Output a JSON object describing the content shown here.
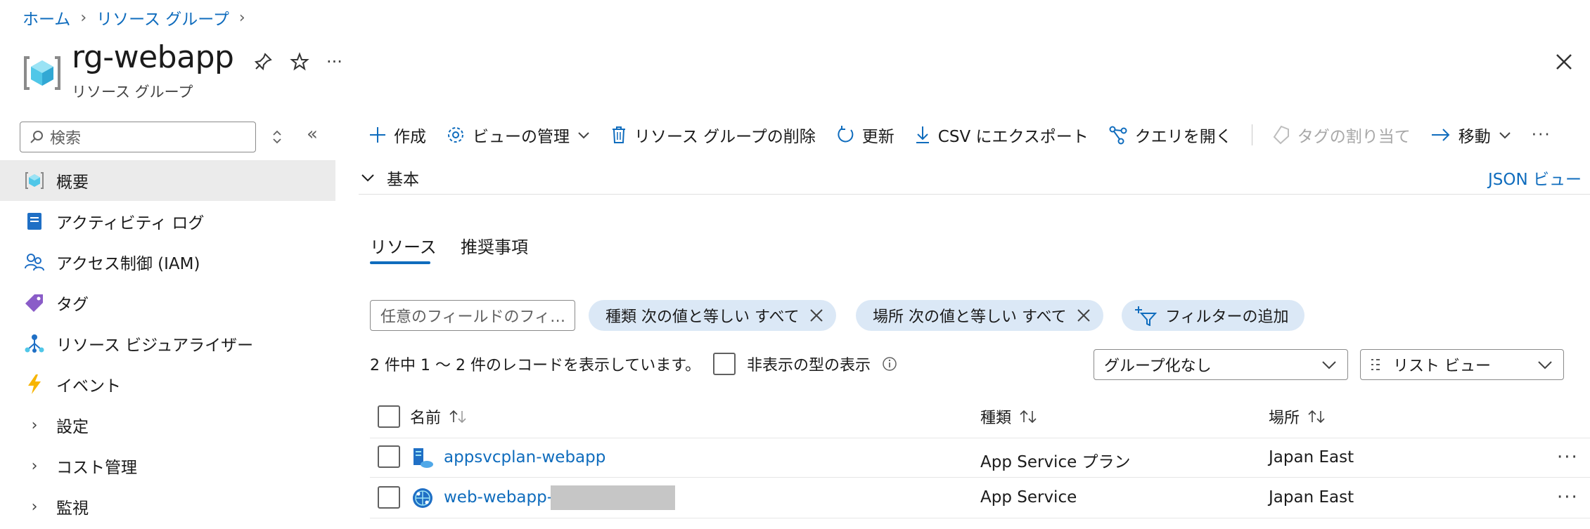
{
  "breadcrumb": {
    "home": "ホーム",
    "resource_groups": "リソース グループ"
  },
  "header": {
    "title": "rg-webapp",
    "subtitle": "リソース グループ"
  },
  "sidebar": {
    "search_placeholder": "検索",
    "items": [
      {
        "label": "概要",
        "icon": "resource-group-icon",
        "active": true
      },
      {
        "label": "アクティビティ ログ",
        "icon": "activity-log-icon"
      },
      {
        "label": "アクセス制御 (IAM)",
        "icon": "iam-icon"
      },
      {
        "label": "タグ",
        "icon": "tag-icon"
      },
      {
        "label": "リソース ビジュアライザー",
        "icon": "visualizer-icon"
      },
      {
        "label": "イベント",
        "icon": "lightning-icon"
      },
      {
        "label": "設定",
        "expandable": true
      },
      {
        "label": "コスト管理",
        "expandable": true
      },
      {
        "label": "監視",
        "expandable": true
      }
    ]
  },
  "toolbar": {
    "create": "作成",
    "manage_view": "ビューの管理",
    "delete_rg": "リソース グループの削除",
    "refresh": "更新",
    "export_csv": "CSV にエクスポート",
    "open_query": "クエリを開く",
    "assign_tags": "タグの割り当て",
    "move": "移動"
  },
  "essentials": {
    "label": "基本",
    "json_view": "JSON ビュー"
  },
  "tabs": {
    "resources": "リソース",
    "recommendations": "推奨事項"
  },
  "filters": {
    "field_placeholder": "任意のフィールドのフィ…",
    "type_pill": "種類 次の値と等しい すべて",
    "location_pill": "場所 次の値と等しい すべて",
    "add_filter": "フィルターの追加"
  },
  "list": {
    "record_count": "2 件中 1 ～ 2 件のレコードを表示しています。",
    "show_hidden": "非表示の型の表示",
    "grouping": "グループ化なし",
    "view_mode": "リスト ビュー",
    "columns": {
      "name": "名前",
      "type": "種類",
      "location": "場所"
    },
    "rows": [
      {
        "name": "appsvcplan-webapp",
        "type": "App Service プラン",
        "location": "Japan East"
      },
      {
        "name": "web-webapp-",
        "type": "App Service",
        "location": "Japan East"
      }
    ]
  },
  "colors": {
    "accent": "#0f6cbd",
    "active_bg": "#ebebeb",
    "pill_bg": "#dbe8f6"
  }
}
